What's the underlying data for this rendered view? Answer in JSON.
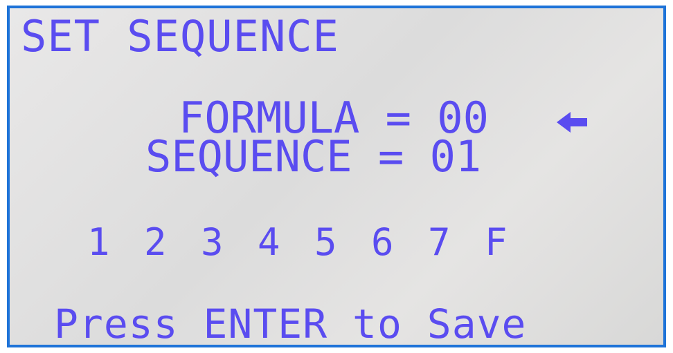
{
  "screen": {
    "title": "SET SEQUENCE",
    "formula_line": "FORMULA = 00",
    "sequence_line": "SEQUENCE = 01",
    "steps": [
      "1",
      "2",
      "3",
      "4",
      "5",
      "6",
      "7",
      "F"
    ],
    "footer": "Press ENTER to Save",
    "cursor_icon": "left-arrow-icon",
    "colors": {
      "text": "#5a4cf0",
      "frame": "#1e73d8",
      "background": "#e2e1e1"
    }
  }
}
